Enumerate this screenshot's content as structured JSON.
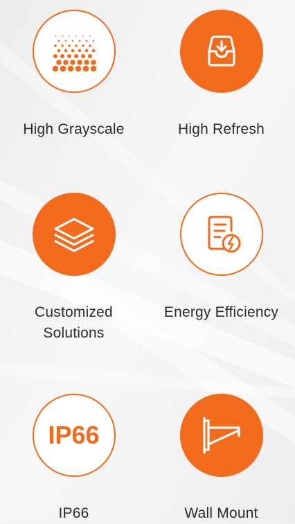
{
  "colors": {
    "accent": "#f26b1d",
    "text": "#2b2b2b",
    "background": "#f2f2f2"
  },
  "features": [
    {
      "label": "High Grayscale",
      "icon": "grayscale-dots-icon",
      "style": "outline"
    },
    {
      "label": "High Refresh",
      "icon": "inbox-download-icon",
      "style": "filled"
    },
    {
      "label": "Customized\nSolutions",
      "icon": "layers-icon",
      "style": "filled"
    },
    {
      "label": "Energy Efficiency",
      "icon": "document-energy-icon",
      "style": "outline"
    },
    {
      "label": "IP66",
      "icon": "ip66-badge-icon",
      "style": "outline",
      "badge_text": "IP66"
    },
    {
      "label": "Wall Mount",
      "icon": "wall-mount-bracket-icon",
      "style": "filled"
    }
  ]
}
